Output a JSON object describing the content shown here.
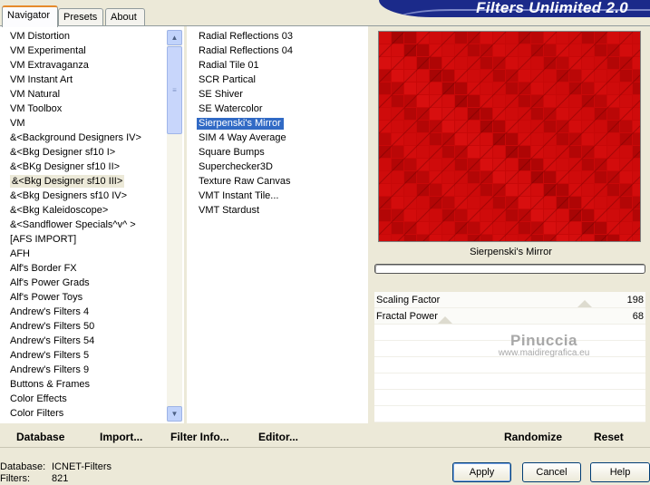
{
  "banner": {
    "title": "Filters Unlimited 2.0"
  },
  "tabs": [
    {
      "label": "Navigator"
    },
    {
      "label": "Presets"
    },
    {
      "label": "About"
    }
  ],
  "categories": [
    "VM Distortion",
    "VM Experimental",
    "VM Extravaganza",
    "VM Instant Art",
    "VM Natural",
    "VM Toolbox",
    "VM",
    "&<Background Designers IV>",
    "&<Bkg Designer sf10 I>",
    "&<BKg Designer sf10 II>",
    "&<Bkg Designer sf10 III>",
    "&<Bkg Designers sf10 IV>",
    "&<Bkg Kaleidoscope>",
    "&<Sandflower Specials^v^ >",
    "[AFS IMPORT]",
    "AFH",
    "Alf's Border FX",
    "Alf's Power Grads",
    "Alf's Power Toys",
    "Andrew's Filters 4",
    "Andrew's Filters 50",
    "Andrew's Filters 54",
    "Andrew's Filters 5",
    "Andrew's Filters 9",
    "Buttons & Frames",
    "Color Effects",
    "Color Filters"
  ],
  "selected_category": "&<Bkg Designer sf10 III>",
  "filters": [
    "Radial Reflections 03",
    "Radial Reflections 04",
    "Radial Tile 01",
    "SCR  Partical",
    "SE Shiver",
    "SE Watercolor",
    "Sierpenski's Mirror",
    "SIM 4 Way Average",
    "Square Bumps",
    "Superchecker3D",
    "Texture Raw Canvas",
    "VMT Instant Tile...",
    "VMT Stardust"
  ],
  "selected_filter": "Sierpenski's Mirror",
  "preview": {
    "label": "Sierpenski's Mirror",
    "color": "#c80808"
  },
  "params": [
    {
      "label": "Scaling Factor",
      "value": "198"
    },
    {
      "label": "Fractal Power",
      "value": "68"
    }
  ],
  "watermark": {
    "line1": "Pinuccia",
    "line2": "www.maidiregrafica.eu"
  },
  "bottom_left_buttons": {
    "database": "Database",
    "import": "Import...",
    "filter_info": "Filter Info...",
    "editor": "Editor..."
  },
  "bottom_right_buttons": {
    "randomize": "Randomize",
    "reset": "Reset"
  },
  "status": {
    "database_label": "Database:",
    "database_value": "ICNET-Filters",
    "filters_label": "Filters:",
    "filters_value": "821"
  },
  "dialog_buttons": {
    "apply": "Apply",
    "cancel": "Cancel",
    "help": "Help"
  },
  "colors": {
    "selection": "#316ac5",
    "banner": "#1b2a8a",
    "tab_accent": "#e68b2c"
  }
}
